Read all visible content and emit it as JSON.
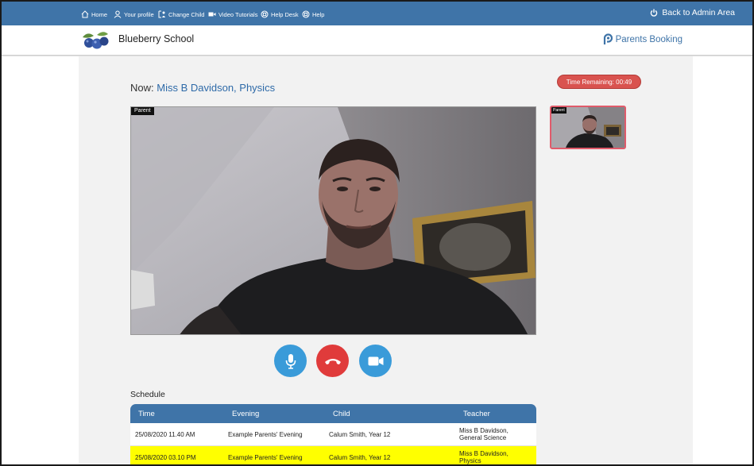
{
  "nav": {
    "items": [
      {
        "label": "Home",
        "icon": "home-icon"
      },
      {
        "label": "Your profile",
        "icon": "user-icon"
      },
      {
        "label": "Change Child",
        "icon": "change-child-icon"
      },
      {
        "label": "Video Tutorials",
        "icon": "video-camera-icon"
      },
      {
        "label": "Help Desk",
        "icon": "lifebuoy-icon"
      },
      {
        "label": "Help",
        "icon": "lifebuoy-icon"
      }
    ],
    "admin_link": "Back to Admin Area"
  },
  "header": {
    "school_name": "Blueberry School",
    "product_name": "Parents Booking"
  },
  "meeting": {
    "now_prefix": "Now:",
    "teacher_subject": "Miss B Davidson, Physics",
    "time_remaining": "Time Remaining: 00:49",
    "main_video_tag": "Parent",
    "self_video_tag": "Parent"
  },
  "controls": {
    "mic": "microphone-icon",
    "hangup": "hang-up-icon",
    "camera": "video-camera-icon"
  },
  "schedule": {
    "title": "Schedule",
    "columns": [
      "Time",
      "Evening",
      "Child",
      "Teacher"
    ],
    "rows": [
      {
        "time": "25/08/2020 11.40 AM",
        "evening": "Example Parents' Evening",
        "child": "Calum Smith, Year 12",
        "teacher_line1": "Miss B Davidson,",
        "teacher_line2": "General Science",
        "current": false
      },
      {
        "time": "25/08/2020 03.10 PM",
        "evening": "Example Parents' Evening",
        "child": "Calum Smith, Year 12",
        "teacher_line1": "Miss B Davidson,",
        "teacher_line2": "Physics",
        "current": true
      }
    ]
  },
  "colors": {
    "nav_bg": "#3f74a8",
    "accent_blue": "#2e6aa8",
    "timer_red": "#d9534f",
    "mic_blue": "#3a9bd9",
    "hangup_red": "#e03b3b",
    "current_row": "#ffff00"
  }
}
